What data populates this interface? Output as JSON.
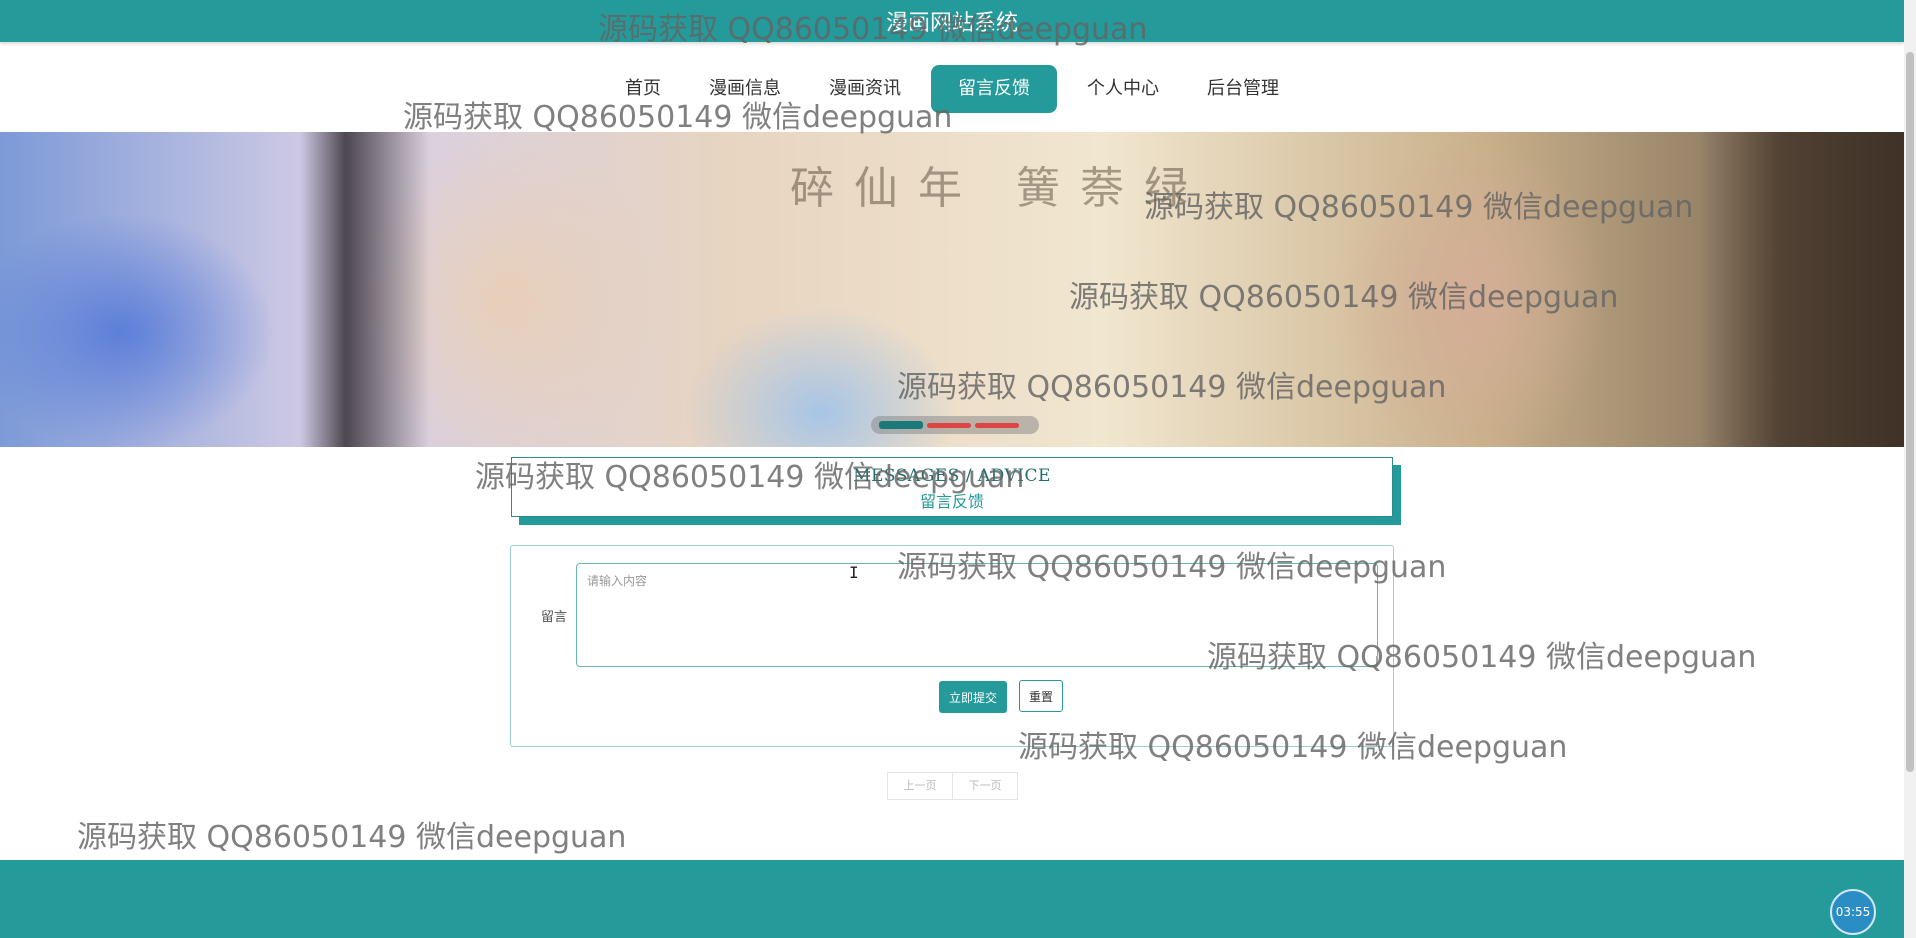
{
  "header": {
    "title": "漫画网站系统"
  },
  "nav": {
    "items": [
      {
        "label": "首页"
      },
      {
        "label": "漫画信息"
      },
      {
        "label": "漫画资讯"
      },
      {
        "label": "留言反馈",
        "active": true
      },
      {
        "label": "个人中心"
      },
      {
        "label": "后台管理"
      }
    ]
  },
  "banner": {
    "calligraphy": "碎仙年 簧萘绿",
    "slides": 3,
    "active_slide": 1
  },
  "section": {
    "title_en": "MESSAGES / ADVICE",
    "title_cn": "留言反馈"
  },
  "form": {
    "label": "留言",
    "placeholder": "请输入内容",
    "submit_label": "立即提交",
    "reset_label": "重置"
  },
  "pager": {
    "prev": "上一页",
    "next": "下一页"
  },
  "timer": {
    "value": "03:55"
  },
  "watermark": {
    "text": "源码获取 QQ86050149 微信deepguan"
  },
  "colors": {
    "primary": "#259a9a",
    "timer": "#2a8ec4"
  }
}
